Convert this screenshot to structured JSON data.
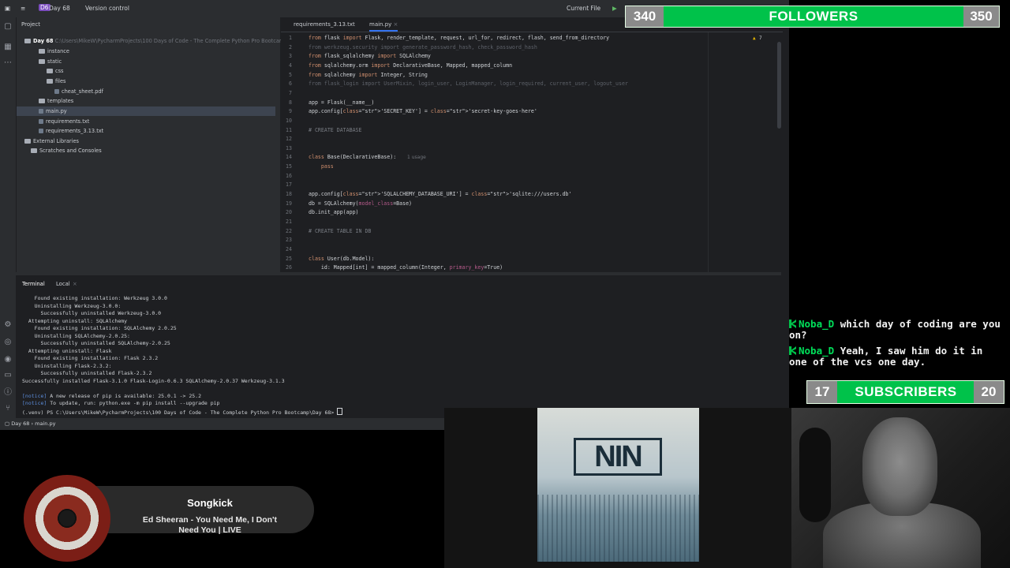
{
  "titlebar": {
    "project_badge": "D6",
    "project_name": "Day 68",
    "vcs": "Version control",
    "run_config": "Current File"
  },
  "project_panel": {
    "title": "Project",
    "tree": [
      {
        "label": "Day 68",
        "path": "C:\\Users\\MikeW\\PycharmProjects\\100 Days of Code - The Complete Python Pro Bootcamp\\Day 68"
      },
      {
        "label": "instance"
      },
      {
        "label": "static"
      },
      {
        "label": "css"
      },
      {
        "label": "files"
      },
      {
        "label": "cheat_sheet.pdf"
      },
      {
        "label": "templates"
      },
      {
        "label": "main.py"
      },
      {
        "label": "requirements.txt"
      },
      {
        "label": "requirements_3.13.txt"
      },
      {
        "label": "External Libraries"
      },
      {
        "label": "Scratches and Consoles"
      }
    ]
  },
  "editor": {
    "tabs": [
      "requirements_3.13.txt",
      "main.py"
    ],
    "warning_count": "7",
    "lines": [
      {
        "n": "1",
        "text": "from flask import Flask, render_template, request, url_for, redirect, flash, send_from_directory"
      },
      {
        "n": "2",
        "text": "from werkzeug.security import generate_password_hash, check_password_hash"
      },
      {
        "n": "3",
        "text": "from flask_sqlalchemy import SQLAlchemy"
      },
      {
        "n": "4",
        "text": "from sqlalchemy.orm import DeclarativeBase, Mapped, mapped_column"
      },
      {
        "n": "5",
        "text": "from sqlalchemy import Integer, String"
      },
      {
        "n": "6",
        "text": "from flask_login import UserMixin, login_user, LoginManager, login_required, current_user, logout_user"
      },
      {
        "n": "7",
        "text": ""
      },
      {
        "n": "8",
        "text": "app = Flask(__name__)"
      },
      {
        "n": "9",
        "text": "app.config['SECRET_KEY'] = 'secret-key-goes-here'"
      },
      {
        "n": "10",
        "text": ""
      },
      {
        "n": "11",
        "text": "# CREATE DATABASE"
      },
      {
        "n": "12",
        "text": ""
      },
      {
        "n": "13",
        "text": ""
      },
      {
        "n": "14",
        "text": "class Base(DeclarativeBase):"
      },
      {
        "n": "15",
        "text": "    pass"
      },
      {
        "n": "16",
        "text": ""
      },
      {
        "n": "17",
        "text": ""
      },
      {
        "n": "18",
        "text": "app.config['SQLALCHEMY_DATABASE_URI'] = 'sqlite:///users.db'"
      },
      {
        "n": "19",
        "text": "db = SQLAlchemy(model_class=Base)"
      },
      {
        "n": "20",
        "text": "db.init_app(app)"
      },
      {
        "n": "21",
        "text": ""
      },
      {
        "n": "22",
        "text": "# CREATE TABLE IN DB"
      },
      {
        "n": "23",
        "text": ""
      },
      {
        "n": "24",
        "text": ""
      },
      {
        "n": "25",
        "text": "class User(db.Model):"
      },
      {
        "n": "26",
        "text": "    id: Mapped[int] = mapped_column(Integer, primary_key=True)"
      }
    ],
    "usage_hint": "1 usage"
  },
  "terminal": {
    "tabs": [
      "Terminal",
      "Local"
    ],
    "lines": [
      "    Found existing installation: Werkzeug 3.0.0",
      "    Uninstalling Werkzeug-3.0.0:",
      "      Successfully uninstalled Werkzeug-3.0.0",
      "  Attempting uninstall: SQLAlchemy",
      "    Found existing installation: SQLAlchemy 2.0.25",
      "    Uninstalling SQLAlchemy-2.0.25:",
      "      Successfully uninstalled SQLAlchemy-2.0.25",
      "  Attempting uninstall: Flask",
      "    Found existing installation: Flask 2.3.2",
      "    Uninstalling Flask-2.3.2:",
      "      Successfully uninstalled Flask-2.3.2",
      "Successfully installed Flask-3.1.0 Flask-Login-0.6.3 SQLAlchemy-2.0.37 Werkzeug-3.1.3"
    ],
    "notice1": "A new release of pip is available: 25.0.1 -> 25.2",
    "notice2": "To update, run: python.exe -m pip install --upgrade pip",
    "prompt": "(.venv) PS C:\\Users\\MikeW\\PycharmProjects\\100 Days of Code - The Complete Python Pro Bootcamp\\Day 68>"
  },
  "statusbar": {
    "crumb1": "Day 68",
    "crumb2": "main.py"
  },
  "followers": {
    "current": "340",
    "label": "FOLLOWERS",
    "goal": "350",
    "progress": 0.0
  },
  "subscribers": {
    "current": "17",
    "label": "SUBSCRIBERS",
    "goal": "20",
    "progress": 0.0
  },
  "chat": [
    {
      "user": "Noba_D",
      "message": "which day of coding are you on?"
    },
    {
      "user": "Noba_D",
      "message": "Yeah, I saw him do it in one of the vcs one day."
    }
  ],
  "songkick": {
    "title": "Songkick",
    "song": "Ed Sheeran - You Need Me, I Don't Need You | LIVE"
  },
  "colors": {
    "accent_green": "#00c24a",
    "ide_bg": "#1e1f22"
  }
}
